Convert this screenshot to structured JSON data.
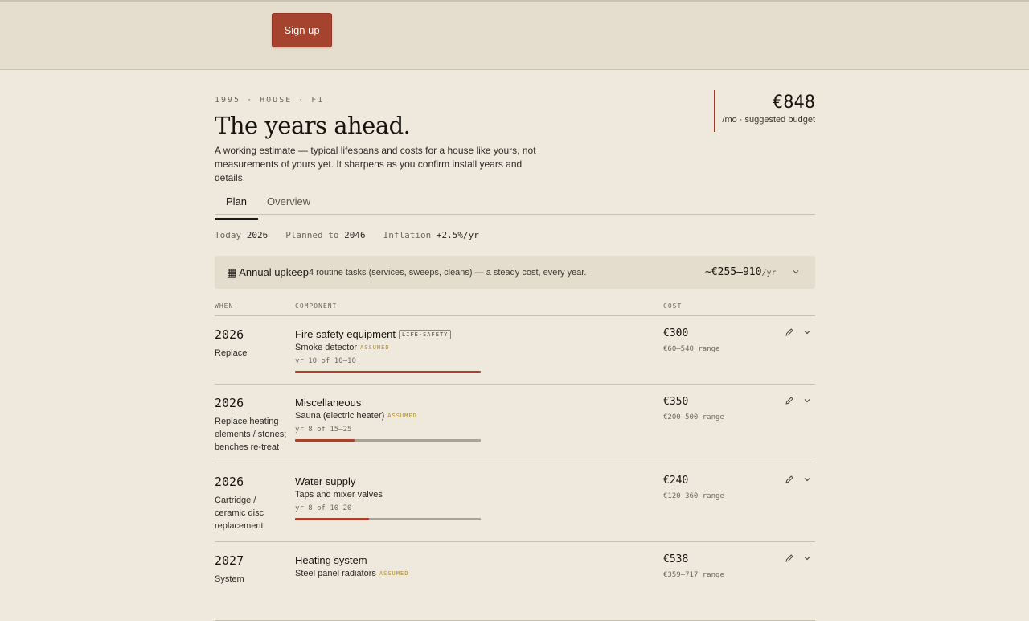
{
  "header": {
    "signup_label": "Sign up"
  },
  "hero": {
    "eyebrow": "1995 · HOUSE · FI",
    "title": "The years ahead.",
    "lede": "A working estimate — typical lifespans and costs for a house like yours, not measurements of yours yet. It sharpens as you confirm install years and details.",
    "budget_amount": "€848",
    "budget_label": "/mo · suggested budget"
  },
  "tabs": [
    {
      "label": "Plan",
      "active": true
    },
    {
      "label": "Overview",
      "active": false
    }
  ],
  "meta": {
    "today_label": "Today",
    "today_value": "2026",
    "planned_label": "Planned to",
    "planned_value": "2046",
    "inflation_label": "Inflation",
    "inflation_value": "+2.5%/yr"
  },
  "upkeep": {
    "icon": "▦",
    "title": "Annual upkeep",
    "description": "4 routine tasks (services, sweeps, cleans) — a steady cost, every year.",
    "cost": "~€255–910",
    "unit": "/yr"
  },
  "columns": {
    "when": "WHEN",
    "component": "COMPONENT",
    "cost": "COST"
  },
  "rows": [
    {
      "year": "2026",
      "action": "Replace",
      "component": "Fire safety equipment",
      "tag": "LIFE-SAFETY",
      "sub": "Smoke detector",
      "assumed": "ASSUMED",
      "yrof": "yr 10 of 10–10",
      "progress": 1.0,
      "cost": "€300",
      "range": "€60–540 range"
    },
    {
      "year": "2026",
      "action": "Replace heating elements / stones; benches re-treat",
      "component": "Miscellaneous",
      "tag": "",
      "sub": "Sauna (electric heater)",
      "assumed": "ASSUMED",
      "yrof": "yr 8 of 15–25",
      "progress": 0.32,
      "cost": "€350",
      "range": "€200–500 range"
    },
    {
      "year": "2026",
      "action": "Cartridge / ceramic disc replacement",
      "component": "Water supply",
      "tag": "",
      "sub": "Taps and mixer valves",
      "assumed": "",
      "yrof": "yr 8 of 10–20",
      "progress": 0.4,
      "cost": "€240",
      "range": "€120–360 range"
    },
    {
      "year": "2027",
      "action": "System",
      "component": "Heating system",
      "tag": "",
      "sub": "Steel panel radiators",
      "assumed": "ASSUMED",
      "yrof": "",
      "progress": 0,
      "cost": "€538",
      "range": "€359–717 range"
    }
  ]
}
